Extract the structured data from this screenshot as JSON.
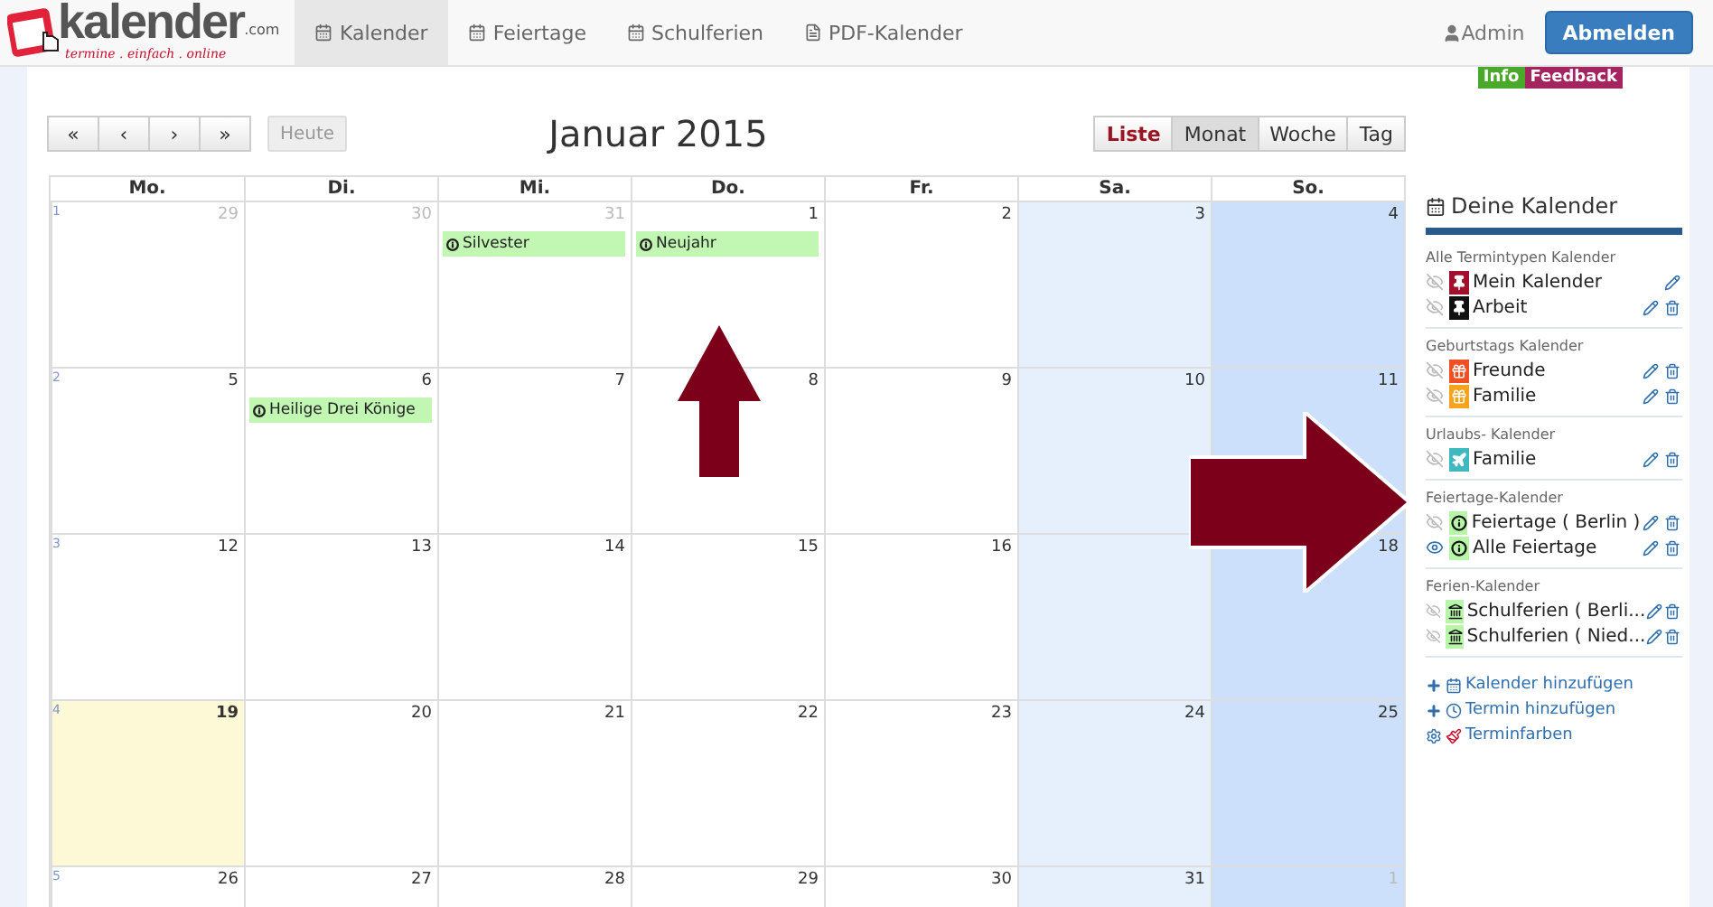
{
  "logo": {
    "name": "kalender",
    "suffix": ".com",
    "tagline": "termine . einfach . online"
  },
  "nav": [
    {
      "label": "Kalender",
      "kind": "calendar",
      "selected": true
    },
    {
      "label": "Feiertage",
      "kind": "calendar",
      "selected": false
    },
    {
      "label": "Schulferien",
      "kind": "calendar",
      "selected": false
    },
    {
      "label": "PDF-Kalender",
      "kind": "file",
      "selected": false
    }
  ],
  "user": {
    "name": "Admin",
    "logout": "Abmelden"
  },
  "badges": [
    {
      "label": "Info",
      "color": "#4aa82a"
    },
    {
      "label": "Feedback",
      "color": "#a3245f"
    }
  ],
  "toolbar": {
    "nav_buttons": [
      "«",
      "‹",
      "›",
      "»"
    ],
    "today": {
      "label": "Heute",
      "disabled": true
    },
    "title": "Januar 2015",
    "views": [
      {
        "label": "Liste",
        "selected": false,
        "highlight": true
      },
      {
        "label": "Monat",
        "selected": true,
        "highlight": false
      },
      {
        "label": "Woche",
        "selected": false,
        "highlight": false
      },
      {
        "label": "Tag",
        "selected": false,
        "highlight": false
      }
    ]
  },
  "weekdays": [
    "Mo.",
    "Di.",
    "Mi.",
    "Do.",
    "Fr.",
    "Sa.",
    "So."
  ],
  "weeks": [
    {
      "number": "1",
      "days": [
        {
          "day": "29",
          "other_month": true,
          "today": false
        },
        {
          "day": "30",
          "other_month": true,
          "today": false
        },
        {
          "day": "31",
          "other_month": true,
          "today": false,
          "events": [
            "Silvester"
          ]
        },
        {
          "day": "1",
          "other_month": false,
          "today": false,
          "events": [
            "Neujahr"
          ]
        },
        {
          "day": "2",
          "other_month": false,
          "today": false
        },
        {
          "day": "3",
          "other_month": false,
          "today": false
        },
        {
          "day": "4",
          "other_month": false,
          "today": false
        }
      ]
    },
    {
      "number": "2",
      "days": [
        {
          "day": "5",
          "other_month": false,
          "today": false
        },
        {
          "day": "6",
          "other_month": false,
          "today": false,
          "events": [
            "Heilige Drei Könige"
          ]
        },
        {
          "day": "7",
          "other_month": false,
          "today": false
        },
        {
          "day": "8",
          "other_month": false,
          "today": false
        },
        {
          "day": "9",
          "other_month": false,
          "today": false
        },
        {
          "day": "10",
          "other_month": false,
          "today": false
        },
        {
          "day": "11",
          "other_month": false,
          "today": false
        }
      ]
    },
    {
      "number": "3",
      "days": [
        {
          "day": "12",
          "other_month": false,
          "today": false
        },
        {
          "day": "13",
          "other_month": false,
          "today": false
        },
        {
          "day": "14",
          "other_month": false,
          "today": false
        },
        {
          "day": "15",
          "other_month": false,
          "today": false
        },
        {
          "day": "16",
          "other_month": false,
          "today": false
        },
        {
          "today": false
        },
        {
          "day": "18",
          "other_month": false,
          "today": false
        }
      ]
    },
    {
      "number": "4",
      "days": [
        {
          "day": "19",
          "other_month": false,
          "today": true
        },
        {
          "day": "20",
          "other_month": false,
          "today": false
        },
        {
          "day": "21",
          "other_month": false,
          "today": false
        },
        {
          "day": "22",
          "other_month": false,
          "today": false
        },
        {
          "day": "23",
          "other_month": false,
          "today": false
        },
        {
          "day": "24",
          "other_month": false,
          "today": false
        },
        {
          "day": "25",
          "other_month": false,
          "today": false
        }
      ]
    },
    {
      "number": "5",
      "days": [
        {
          "day": "26",
          "other_month": false,
          "today": false
        },
        {
          "day": "27",
          "other_month": false,
          "today": false
        },
        {
          "day": "28",
          "other_month": false,
          "today": false
        },
        {
          "day": "29",
          "other_month": false,
          "today": false
        },
        {
          "day": "30",
          "other_month": false,
          "today": false
        },
        {
          "day": "31",
          "other_month": false,
          "today": false
        },
        {
          "day": "1",
          "other_month": true,
          "today": false
        }
      ]
    }
  ],
  "sidebar": {
    "title": "Deine Kalender",
    "groups": [
      {
        "title": "Alle Termintypen Kalender",
        "items": [
          {
            "name": "Mein Kalender",
            "kind": "pin",
            "color": "#a0102c",
            "visible": false,
            "deletable": false
          },
          {
            "name": "Arbeit",
            "kind": "pin",
            "color": "#111111",
            "visible": false,
            "deletable": true
          }
        ]
      },
      {
        "title": "Geburtstags Kalender",
        "items": [
          {
            "name": "Freunde",
            "kind": "gift",
            "color": "#f04e23",
            "visible": false,
            "deletable": true
          },
          {
            "name": "Familie",
            "kind": "gift",
            "color": "#f7a21b",
            "visible": false,
            "deletable": true
          }
        ]
      },
      {
        "title": "Urlaubs- Kalender",
        "items": [
          {
            "name": "Familie",
            "kind": "plane",
            "color": "#3fb8c0",
            "visible": false,
            "deletable": true
          }
        ]
      },
      {
        "title": "Feiertage-Kalender",
        "items": [
          {
            "name": " Feiertage ( Berlin )",
            "kind": "info",
            "color": "#b8f5a8",
            "visible": false,
            "deletable": true
          },
          {
            "name": "Alle Feiertage",
            "kind": "info",
            "color": "#b8f5a8",
            "visible": true,
            "deletable": true
          }
        ]
      },
      {
        "title": "Ferien-Kalender",
        "items": [
          {
            "name": "Schulferien ( Berli...",
            "kind": "bank",
            "color": "#b8f5a8",
            "visible": false,
            "deletable": true
          },
          {
            "name": "Schulferien ( Nied...",
            "kind": "bank",
            "color": "#b8f5a8",
            "visible": false,
            "deletable": true
          }
        ]
      }
    ],
    "links": [
      {
        "label": "Kalender hinzufügen",
        "kind": "calendar"
      },
      {
        "label": "Termin hinzufügen",
        "kind": "clock"
      },
      {
        "label": "Terminfarben",
        "kind": "brush"
      }
    ]
  }
}
